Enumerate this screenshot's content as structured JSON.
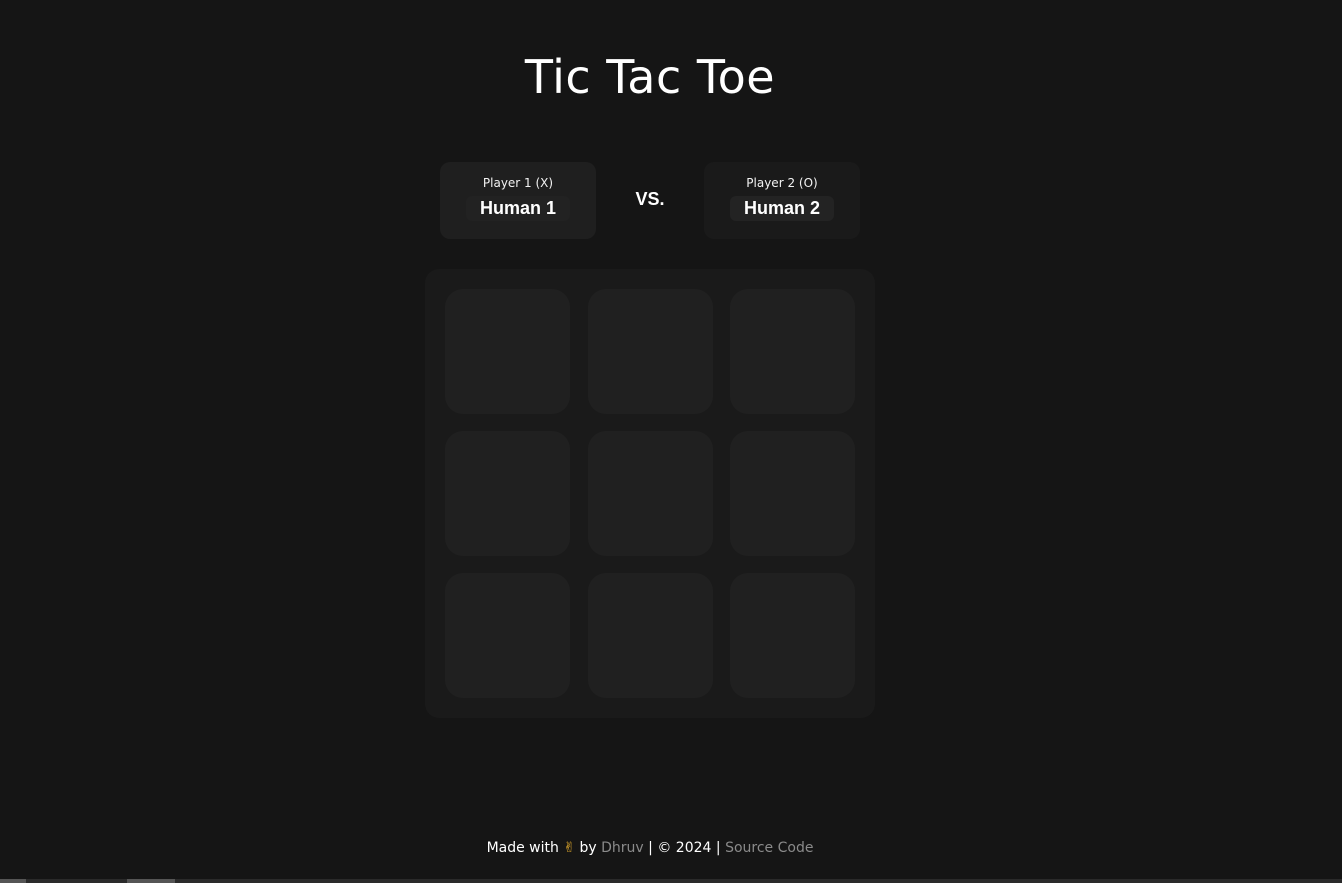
{
  "title": "Tic Tac Toe",
  "players": [
    {
      "label": "Player 1 (X)",
      "name": "Human 1"
    },
    {
      "label": "Player 2 (O)",
      "name": "Human 2"
    }
  ],
  "vs_text": "VS.",
  "board": {
    "cells": [
      "",
      "",
      "",
      "",
      "",
      "",
      "",
      "",
      ""
    ]
  },
  "footer": {
    "made_with": "Made with",
    "emoji": "✌",
    "by": "by",
    "author": "Dhruv",
    "sep1": "|",
    "copyright": "© 2024",
    "sep2": "|",
    "source_link": "Source Code"
  },
  "colors": {
    "background": "#151515",
    "board": "#1a1a1a",
    "cell": "#202020",
    "link": "#8a8a8a"
  }
}
